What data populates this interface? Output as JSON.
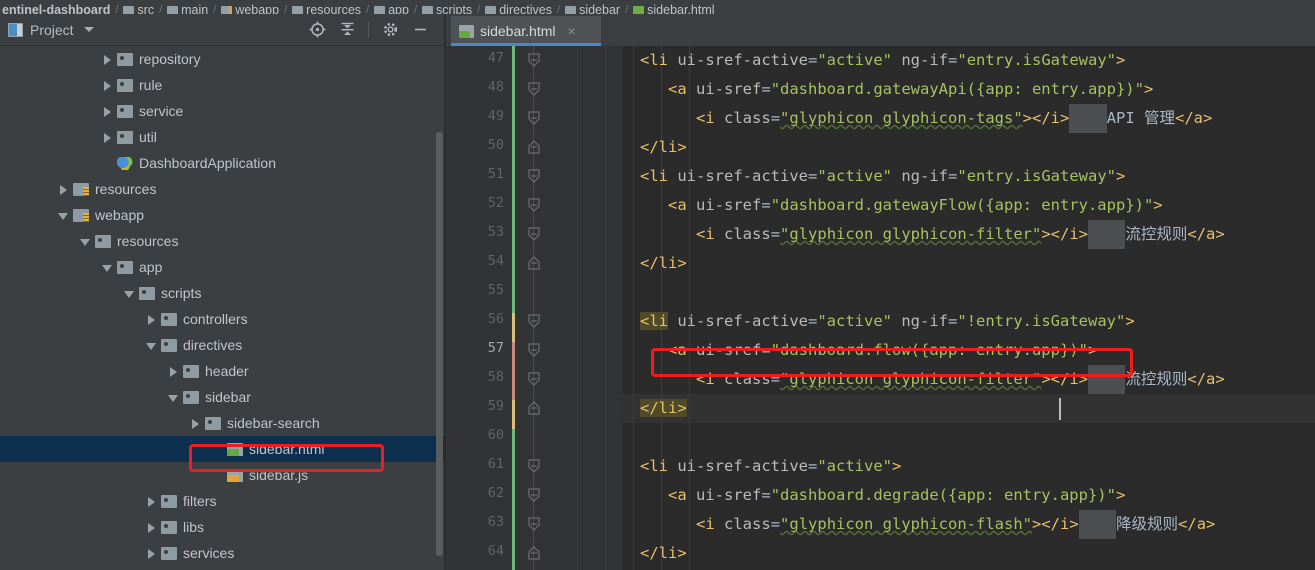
{
  "breadcrumb": {
    "items": [
      {
        "label": "entinel-dashboard",
        "icon": "none",
        "bold": true
      },
      {
        "label": "src",
        "icon": "folder-icon"
      },
      {
        "label": "main",
        "icon": "folder-icon"
      },
      {
        "label": "webapp",
        "icon": "resource-folder-icon"
      },
      {
        "label": "resources",
        "icon": "folder-icon"
      },
      {
        "label": "app",
        "icon": "folder-icon"
      },
      {
        "label": "scripts",
        "icon": "folder-icon"
      },
      {
        "label": "directives",
        "icon": "folder-icon"
      },
      {
        "label": "sidebar",
        "icon": "folder-icon"
      },
      {
        "label": "sidebar.html",
        "icon": "html-file-icon"
      }
    ],
    "separator": "/"
  },
  "project_panel": {
    "title": "Project",
    "tools": [
      {
        "name": "locate-target-icon",
        "tooltip": "Select Opened File"
      },
      {
        "name": "collapse-all-icon",
        "tooltip": "Collapse All"
      },
      {
        "name": "gear-icon",
        "tooltip": "Settings"
      },
      {
        "name": "minimize-icon",
        "tooltip": "Hide"
      }
    ],
    "tree": [
      {
        "label": "repository",
        "indent": 4,
        "arrow": "closed",
        "icon": "folder-icon",
        "selected": false
      },
      {
        "label": "rule",
        "indent": 4,
        "arrow": "closed",
        "icon": "folder-icon",
        "selected": false
      },
      {
        "label": "service",
        "indent": 4,
        "arrow": "closed",
        "icon": "folder-icon",
        "selected": false
      },
      {
        "label": "util",
        "indent": 4,
        "arrow": "closed",
        "icon": "folder-icon",
        "selected": false
      },
      {
        "label": "DashboardApplication",
        "indent": 4,
        "arrow": "none",
        "icon": "java-class-icon",
        "selected": false
      },
      {
        "label": "resources",
        "indent": 2,
        "arrow": "closed",
        "icon": "resource-folder-icon",
        "selected": false
      },
      {
        "label": "webapp",
        "indent": 2,
        "arrow": "open",
        "icon": "resource-folder-icon",
        "selected": false
      },
      {
        "label": "resources",
        "indent": 3,
        "arrow": "open",
        "icon": "folder-icon",
        "selected": false
      },
      {
        "label": "app",
        "indent": 4,
        "arrow": "open",
        "icon": "folder-icon",
        "selected": false
      },
      {
        "label": "scripts",
        "indent": 5,
        "arrow": "open",
        "icon": "folder-icon",
        "selected": false
      },
      {
        "label": "controllers",
        "indent": 6,
        "arrow": "closed",
        "icon": "folder-icon",
        "selected": false
      },
      {
        "label": "directives",
        "indent": 6,
        "arrow": "open",
        "icon": "folder-icon",
        "selected": false
      },
      {
        "label": "header",
        "indent": 7,
        "arrow": "closed",
        "icon": "folder-icon",
        "selected": false
      },
      {
        "label": "sidebar",
        "indent": 7,
        "arrow": "open",
        "icon": "folder-icon",
        "selected": false
      },
      {
        "label": "sidebar-search",
        "indent": 8,
        "arrow": "closed",
        "icon": "folder-icon",
        "selected": false
      },
      {
        "label": "sidebar.html",
        "indent": 9,
        "arrow": "none",
        "icon": "html-file-icon",
        "selected": true
      },
      {
        "label": "sidebar.js",
        "indent": 9,
        "arrow": "none",
        "icon": "js-file-icon",
        "selected": false
      },
      {
        "label": "filters",
        "indent": 6,
        "arrow": "closed",
        "icon": "folder-icon",
        "selected": false
      },
      {
        "label": "libs",
        "indent": 6,
        "arrow": "closed",
        "icon": "folder-icon",
        "selected": false
      },
      {
        "label": "services",
        "indent": 6,
        "arrow": "closed",
        "icon": "folder-icon",
        "selected": false
      }
    ]
  },
  "editor": {
    "tab": {
      "label": "sidebar.html",
      "close": "×",
      "icon": "html-file-icon",
      "active": true
    },
    "first_line_number": 47,
    "caret_line": 57,
    "line_numbers": [
      47,
      48,
      49,
      50,
      51,
      52,
      53,
      54,
      55,
      56,
      57,
      58,
      59,
      60,
      61,
      62,
      63,
      64
    ],
    "lines": [
      {
        "n": 47,
        "indent": 0,
        "text": "<li ui-sref-active=\"active\" ng-if=\"entry.isGateway\">"
      },
      {
        "n": 48,
        "indent": 1,
        "text": "<a ui-sref=\"dashboard.gatewayApi({app: entry.app})\">"
      },
      {
        "n": 49,
        "indent": 2,
        "text": "<i class=\"glyphicon glyphicon-tags\"></i>    API 管理</a>"
      },
      {
        "n": 50,
        "indent": 0,
        "text": "</li>"
      },
      {
        "n": 51,
        "indent": 0,
        "text": "<li ui-sref-active=\"active\" ng-if=\"entry.isGateway\">"
      },
      {
        "n": 52,
        "indent": 1,
        "text": "<a ui-sref=\"dashboard.gatewayFlow({app: entry.app})\">"
      },
      {
        "n": 53,
        "indent": 2,
        "text": "<i class=\"glyphicon glyphicon-filter\"></i>    流控规则</a>"
      },
      {
        "n": 54,
        "indent": 0,
        "text": "</li>"
      },
      {
        "n": 55,
        "indent": 0,
        "text": ""
      },
      {
        "n": 56,
        "indent": 0,
        "text": "<li ui-sref-active=\"active\" ng-if=\"!entry.isGateway\">"
      },
      {
        "n": 57,
        "indent": 1,
        "text": "<a ui-sref=\"dashboard.flow({app: entry.app})\">"
      },
      {
        "n": 58,
        "indent": 2,
        "text": "<i class=\"glyphicon glyphicon-filter\"></i>    流控规则</a>"
      },
      {
        "n": 59,
        "indent": 0,
        "text": "</li>"
      },
      {
        "n": 60,
        "indent": 0,
        "text": ""
      },
      {
        "n": 61,
        "indent": 0,
        "text": "<li ui-sref-active=\"active\">"
      },
      {
        "n": 62,
        "indent": 1,
        "text": "<a ui-sref=\"dashboard.degrade({app: entry.app})\">"
      },
      {
        "n": 63,
        "indent": 2,
        "text": "<i class=\"glyphicon glyphicon-flash\"></i>    降级规则</a>"
      },
      {
        "n": 64,
        "indent": 0,
        "text": "</li>"
      }
    ]
  },
  "annotations": [
    {
      "name": "sidebar-html-tree-highlight",
      "shape": "rectangle",
      "color": "#f11c1c"
    },
    {
      "name": "flow-link-code-highlight",
      "shape": "rectangle",
      "color": "#f11c1c"
    }
  ],
  "colors": {
    "panel_bg": "#3c3f41",
    "editor_bg": "#2b2b2b",
    "gutter_bg": "#313335",
    "selection_bg": "#0d2f4f",
    "tab_active_underline": "#4a88c7",
    "annotation_red": "#f11c1c",
    "vcs_added": "#6dbb76",
    "vcs_modified": "#e0a341",
    "matched_tag_bg": "#4f4b28",
    "tag_color": "#e8bf6a",
    "attr_value_color": "#a5c261",
    "text_color": "#a9b7c6"
  }
}
